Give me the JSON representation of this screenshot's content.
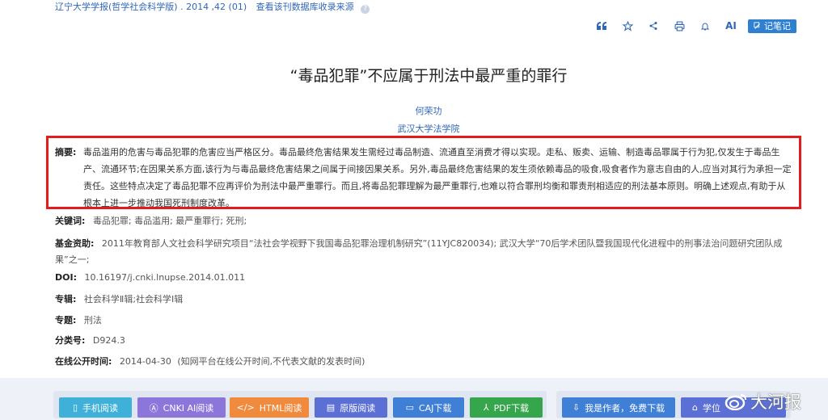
{
  "journal": {
    "source": "辽宁大学学报(哲学社会科学版) . 2014 ,42 (01)",
    "db_note": "查看该刊数据库收录来源"
  },
  "toolbar": {
    "ai_label": "AI",
    "note_label": "记笔记"
  },
  "article": {
    "title": "“毒品犯罪”不应属于刑法中最严重的罪行",
    "author": "何荣功",
    "organization": "武汉大学法学院",
    "abstract_label": "摘要:",
    "abstract": "毒品滥用的危害与毒品犯罪的危害应当严格区分。毒品最终危害结果发生需经过毒品制造、流通直至消费才得以实现。走私、贩卖、运输、制造毒品罪属于行为犯,仅发生于毒品生产、流通环节;在因果关系方面,该行为与毒品最终危害结果之间属于间接因果关系。另外,毒品最终危害结果的发生须依赖毒品的吸食,吸食者作为意志自由的人,应当对其行为承担一定责任。这些特点决定了毒品犯罪不应再评价为刑法中最严重罪行。而且,将毒品犯罪理解为最严重罪行,也难以符合罪刑均衡和罪责刑相适应的刑法基本原则。明确上述观点,有助于从根本上进一步推动我国死刑制度改革。",
    "keywords_label": "关键词:",
    "keywords": "毒品犯罪;  毒品滥用;  最严重罪行;  死刑;",
    "fund_label": "基金资助:",
    "fund": "2011年教育部人文社会科学研究项目“法社会学视野下我国毒品犯罪治理机制研究”(11YJC820034);  武汉大学“70后学术团队暨我国现代化进程中的刑事法治问题研究团队成果”之一;",
    "doi_label": "DOI:",
    "doi": "10.16197/j.cnki.lnupse.2014.01.011",
    "series_label": "专辑:",
    "series": "社会科学Ⅱ辑;社会科学Ⅰ辑",
    "subject_label": "专题:",
    "subject": "刑法",
    "class_label": "分类号:",
    "class_no": "D924.3",
    "pubdate_label": "在线公开时间:",
    "pubdate": "2014-04-30",
    "pubdate_note": "(知网平台在线公开时间,不代表文献的发表时间)"
  },
  "bottom_buttons": [
    {
      "label": "手机阅读",
      "color": "#3fb1d8"
    },
    {
      "label": "CNKI AI阅读",
      "color": "#8c76d9"
    },
    {
      "label": "HTML阅读",
      "color": "#f08a3c"
    },
    {
      "label": "原版阅读",
      "color": "#5b6fd4"
    },
    {
      "label": "CAJ下载",
      "color": "#3f7fd6"
    },
    {
      "label": "PDF下载",
      "color": "#35a64b"
    },
    {
      "label": "我是作者，免费下载",
      "color": "#3f7fd6"
    },
    {
      "label": "学位",
      "color": "#5b6fd4"
    }
  ],
  "watermark": "大河报"
}
